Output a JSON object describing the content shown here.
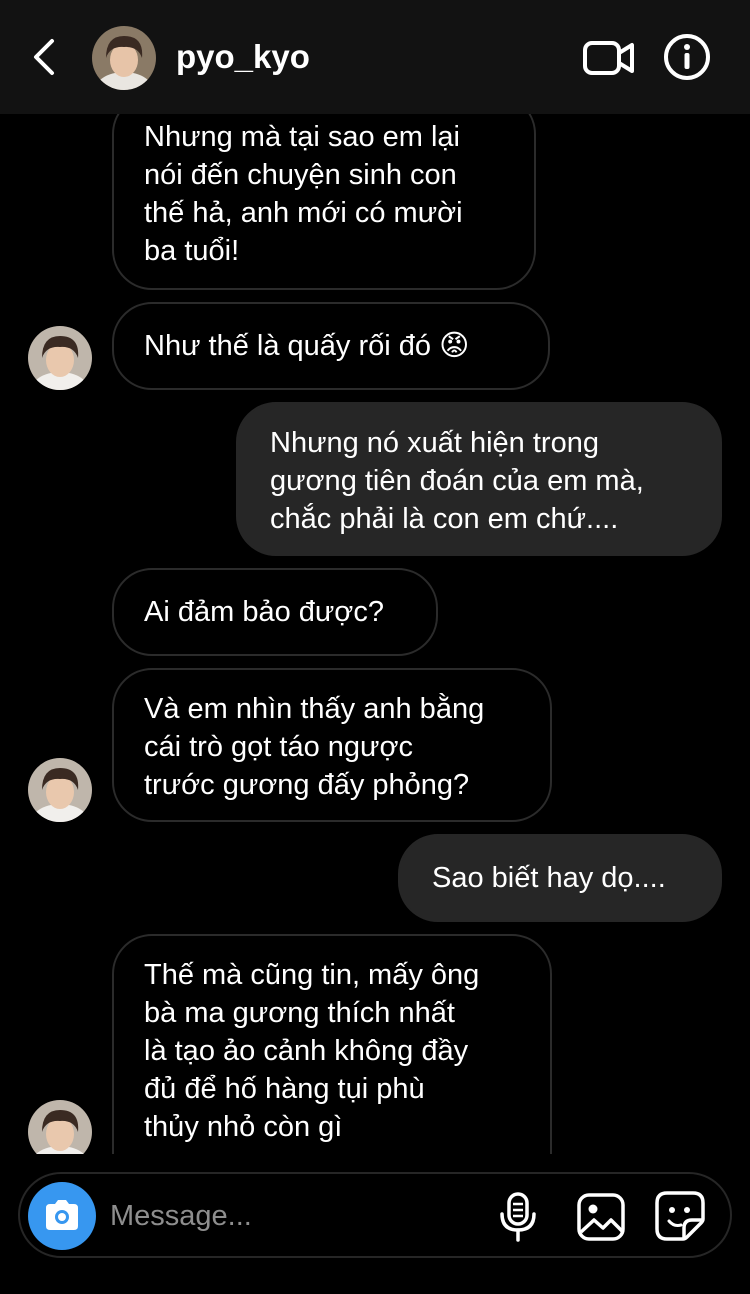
{
  "header": {
    "username": "pyo_kyo",
    "icons": [
      "back-chevron-icon",
      "video-call-icon",
      "info-icon"
    ]
  },
  "messages": [
    {
      "from": "them",
      "text": "Nhưng mà tại sao em lại\nnói đến chuyện sinh con\nthế hả, anh mới có mười\nba tuổi!"
    },
    {
      "from": "them",
      "text": "Như thế là quấy rối đó 😡",
      "avatar": true
    },
    {
      "from": "me",
      "text": "Nhưng nó xuất hiện trong\ngương tiên đoán của em mà,\nchắc phải là con em chứ...."
    },
    {
      "from": "them",
      "text": "Ai đảm bảo được?"
    },
    {
      "from": "them",
      "text": "Và em nhìn thấy anh bằng\ncái trò gọt táo ngược\ntrước gương đấy phỏng?",
      "avatar": true
    },
    {
      "from": "me",
      "text": "Sao biết hay dọ...."
    },
    {
      "from": "them",
      "text": "Thế mà cũng tin, mấy ông\nbà ma gương thích nhất\nlà tạo ảo cảnh không đầy\nđủ để hố hàng tụi phù\nthủy nhỏ còn gì",
      "avatar": true
    }
  ],
  "composer": {
    "placeholder": "Message...",
    "icons": [
      "camera-icon",
      "microphone-icon",
      "gallery-icon",
      "sticker-icon"
    ]
  },
  "colors": {
    "background": "#000000",
    "header_bg": "#121212",
    "sent_bubble": "#262626",
    "received_border": "#2b2b2b",
    "camera_accent": "#3797f0",
    "placeholder": "#8e8e8e"
  }
}
